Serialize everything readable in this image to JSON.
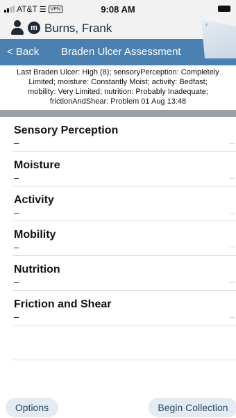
{
  "status_bar": {
    "carrier": "AT&T",
    "vpn": "VPN",
    "time": "9:08 AM"
  },
  "patient": {
    "name": "Burns, Frank",
    "badge": "m"
  },
  "nav": {
    "back_label": "< Back",
    "title": "Braden Ulcer Assessment"
  },
  "summary": {
    "lines": [
      "Last Braden Ulcer: High (8); sensoryPerception: Completely",
      "Limited; moisture: Constantly Moist; activity: Bedfast;",
      "mobility: Very Limited; nutrition: Probably Inadequate;",
      "frictionAndShear: Problem 01 Aug 13:48"
    ]
  },
  "items": [
    {
      "label": "Sensory Perception",
      "value": "–",
      "right": "–"
    },
    {
      "label": "Moisture",
      "value": "–",
      "right": "–"
    },
    {
      "label": "Activity",
      "value": "–",
      "right": "–"
    },
    {
      "label": "Mobility",
      "value": "–",
      "right": "–"
    },
    {
      "label": "Nutrition",
      "value": "–",
      "right": "–"
    },
    {
      "label": "Friction and Shear",
      "value": "–",
      "right": "–"
    }
  ],
  "footer": {
    "options_label": "Options",
    "begin_label": "Begin Collection"
  },
  "colors": {
    "nav_bar": "#4b80b3",
    "header_bg": "#f2f2f2",
    "button_bg": "#e4ebf2",
    "button_text": "#24476b"
  },
  "icons": {
    "patient": "person-icon",
    "badge": "m-badge-icon",
    "signal": "signal-icon",
    "wifi": "wifi-icon",
    "battery": "battery-icon",
    "tab": "chevron-left-icon"
  }
}
